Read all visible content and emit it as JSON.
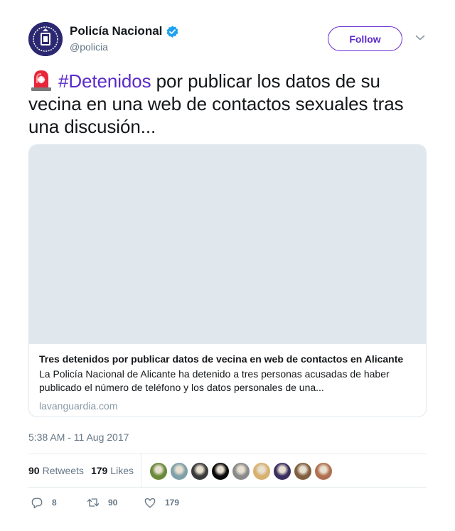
{
  "account": {
    "display_name": "Policía Nacional",
    "handle": "@policia"
  },
  "follow_label": "Follow",
  "tweet": {
    "hashtag": "#Detenidos",
    "text": " por publicar los datos de su vecina en una web de contactos sexuales tras una discusión..."
  },
  "card": {
    "title": "Tres detenidos por publicar datos de vecina en web de contactos en Alicante",
    "description": "La Policía Nacional de Alicante ha detenido a tres personas acusadas de haber publicado el número de teléfono y los datos personales de una...",
    "domain": "lavanguardia.com"
  },
  "timestamp": "5:38 AM - 11 Aug 2017",
  "stats": {
    "retweets_count": "90",
    "retweets_label": "Retweets",
    "likes_count": "179",
    "likes_label": "Likes"
  },
  "liker_avatars": [
    {
      "color": "#6a8a3a"
    },
    {
      "color": "#7fa0a8"
    },
    {
      "color": "#3a3a3a"
    },
    {
      "color": "#0a0a0a"
    },
    {
      "color": "#8a8a8a"
    },
    {
      "color": "#d8b070"
    },
    {
      "color": "#3a3060"
    },
    {
      "color": "#806040"
    },
    {
      "color": "#b07050"
    }
  ],
  "actions": {
    "replies": "8",
    "retweets": "90",
    "likes": "179"
  },
  "colors": {
    "accent": "#5b2bc9",
    "verified": "#1da1f2",
    "muted": "#657786"
  }
}
